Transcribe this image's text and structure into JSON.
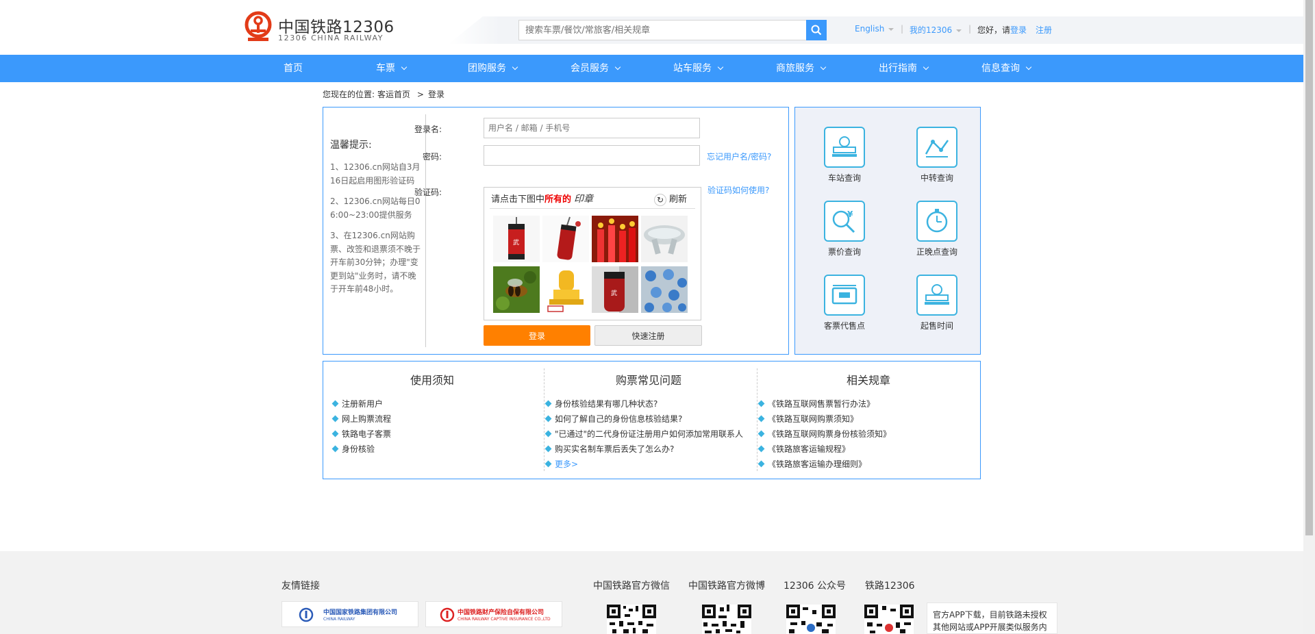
{
  "header": {
    "logo_cn": "中国铁路12306",
    "logo_en": "12306 CHINA RAILWAY",
    "search_placeholder": "搜索车票/餐饮/常旅客/相关规章",
    "lang": "English",
    "my12306": "我的12306",
    "greeting": "您好，请",
    "login_link": "登录",
    "register_link": "注册",
    "separator": "|"
  },
  "nav": {
    "items": [
      {
        "label": "首页",
        "dropdown": false
      },
      {
        "label": "车票",
        "dropdown": true
      },
      {
        "label": "团购服务",
        "dropdown": true
      },
      {
        "label": "会员服务",
        "dropdown": true
      },
      {
        "label": "站车服务",
        "dropdown": true
      },
      {
        "label": "商旅服务",
        "dropdown": true
      },
      {
        "label": "出行指南",
        "dropdown": true
      },
      {
        "label": "信息查询",
        "dropdown": true
      }
    ]
  },
  "breadcrumb": {
    "prefix": "您现在的位置:",
    "home": "客运首页",
    "sep": ">",
    "current": "登录"
  },
  "tips": {
    "title": "温馨提示:",
    "items": [
      "1、12306.cn网站自3月16日起启用图形验证码",
      "2、12306.cn网站每日06:00~23:00提供服务",
      "3、在12306.cn网站购票、改签和退票须不晚于开车前30分钟；办理\"变更到站\"业务时，请不晚于开车前48小时。"
    ]
  },
  "form": {
    "username_label": "登录名:",
    "username_placeholder": "用户名 / 邮箱 / 手机号",
    "password_label": "密码:",
    "forgot_link": "忘记用户名/密码?",
    "captcha_label": "验证码:",
    "captcha_help_link": "验证码如何使用?",
    "captcha_prompt": "请点击下图中",
    "captcha_emphasis": "所有的",
    "captcha_word": "印章",
    "refresh_label": "刷新",
    "login_button": "登录",
    "quick_register_button": "快速注册"
  },
  "captcha_images": [
    "punching-bag",
    "punching-bag-2",
    "red-candles",
    "ceramic-object",
    "bee-on-flower",
    "yellow-stamp",
    "punching-bag-3",
    "blue-toy-cars"
  ],
  "services": [
    {
      "label": "车站查询",
      "icon": "station-icon"
    },
    {
      "label": "中转查询",
      "icon": "transfer-icon"
    },
    {
      "label": "票价查询",
      "icon": "fare-icon"
    },
    {
      "label": "正晚点查询",
      "icon": "clock-icon"
    },
    {
      "label": "客票代售点",
      "icon": "ticket-agency-icon"
    },
    {
      "label": "起售时间",
      "icon": "sale-time-icon"
    }
  ],
  "info": {
    "col1": {
      "title": "使用须知",
      "items": [
        "注册新用户",
        "网上购票流程",
        "铁路电子客票",
        "身份核验"
      ]
    },
    "col2": {
      "title": "购票常见问题",
      "items": [
        "身份核验结果有哪几种状态?",
        "如何了解自己的身份信息核验结果?",
        "\"已通过\"的二代身份证注册用户如何添加常用联系人",
        "购买实名制车票后丢失了怎么办?"
      ],
      "more": "更多>"
    },
    "col3": {
      "title": "相关规章",
      "items": [
        "《铁路互联网售票暂行办法》",
        "《铁路互联网购票须知》",
        "《铁路互联网购票身份核验须知》",
        "《铁路旅客运输规程》",
        "《铁路旅客运输办理细则》"
      ]
    }
  },
  "footer": {
    "links_title": "友情链接",
    "logo1_title": "中国国家铁路集团有限公司",
    "logo1_sub": "CHINA RAILWAY",
    "logo2_title": "中国铁路财产保险自保有限公司",
    "logo2_sub": "CHINA RAILWAY CAPTIVE INSURANCE CO.,LTD",
    "qr_titles": [
      "中国铁路官方微信",
      "中国铁路官方微博",
      "12306 公众号",
      "铁路12306"
    ],
    "app_text": "官方APP下载，目前铁路未授权其他网站或APP开展类似服务内容"
  },
  "colors": {
    "brand_blue": "#3b99fc",
    "login_orange": "#ff8000",
    "logo_red": "#e23b18",
    "icon_cyan": "#3bb3e0"
  }
}
